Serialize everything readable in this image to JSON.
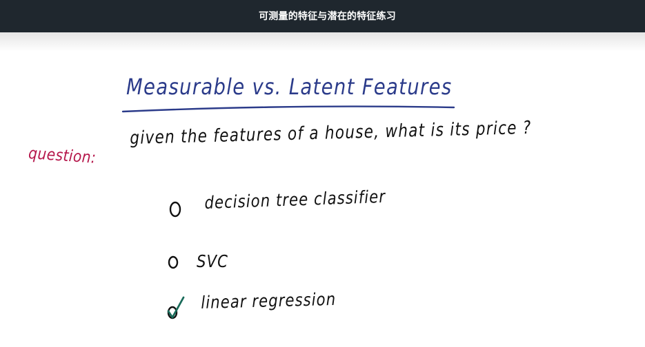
{
  "header": {
    "title": "可测量的特征与潜在的特征练习"
  },
  "slide": {
    "title": "Measurable vs. Latent Features",
    "question_label": "question:",
    "question_text": "given the features of a house, what is its price ?",
    "options": [
      {
        "label": "decision tree classifier",
        "checked": false
      },
      {
        "label": "SVC",
        "checked": false
      },
      {
        "label": "linear regression",
        "checked": true
      }
    ]
  },
  "colors": {
    "header_bg": "#1f272e",
    "title_ink": "#2b3b8a",
    "question_label_ink": "#b5164a",
    "body_ink": "#111111",
    "check_ink": "#1a6b5a"
  }
}
